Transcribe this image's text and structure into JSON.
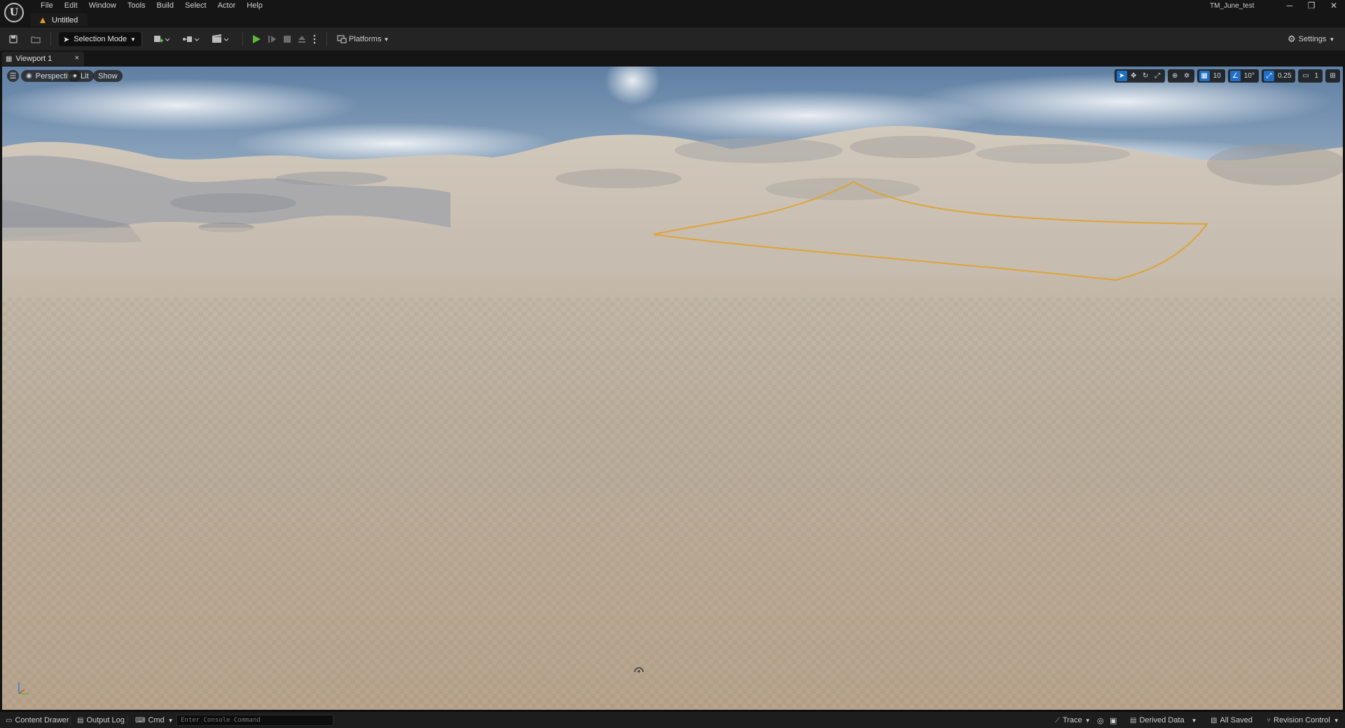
{
  "app": {
    "logo_letter": "U",
    "project_name": "TM_June_test"
  },
  "menu": [
    "File",
    "Edit",
    "Window",
    "Tools",
    "Build",
    "Select",
    "Actor",
    "Help"
  ],
  "document_tab": {
    "label": "Untitled"
  },
  "window_controls": {
    "minimize": "─",
    "restore": "❐",
    "close": "✕"
  },
  "toolbar": {
    "selection_mode": "Selection Mode",
    "platforms": "Platforms",
    "settings": "Settings",
    "play_color": "#5fb83c"
  },
  "viewport_tab": {
    "label": "Viewport 1",
    "close": "×"
  },
  "viewport": {
    "menu_glyph": "☰",
    "view_mode": "Perspective",
    "lighting_mode": "Lit",
    "show_label": "Show",
    "grid_snap": "10",
    "rotation_snap": "10°",
    "scale_snap": "0.25",
    "camera_speed": "1",
    "spline_color": "#e0a12c"
  },
  "status": {
    "content_drawer": "Content Drawer",
    "output_log": "Output Log",
    "cmd": "Cmd",
    "console_placeholder": "Enter Console Command",
    "trace": "Trace",
    "derived_data": "Derived Data",
    "all_saved": "All Saved",
    "revision_control": "Revision Control"
  }
}
